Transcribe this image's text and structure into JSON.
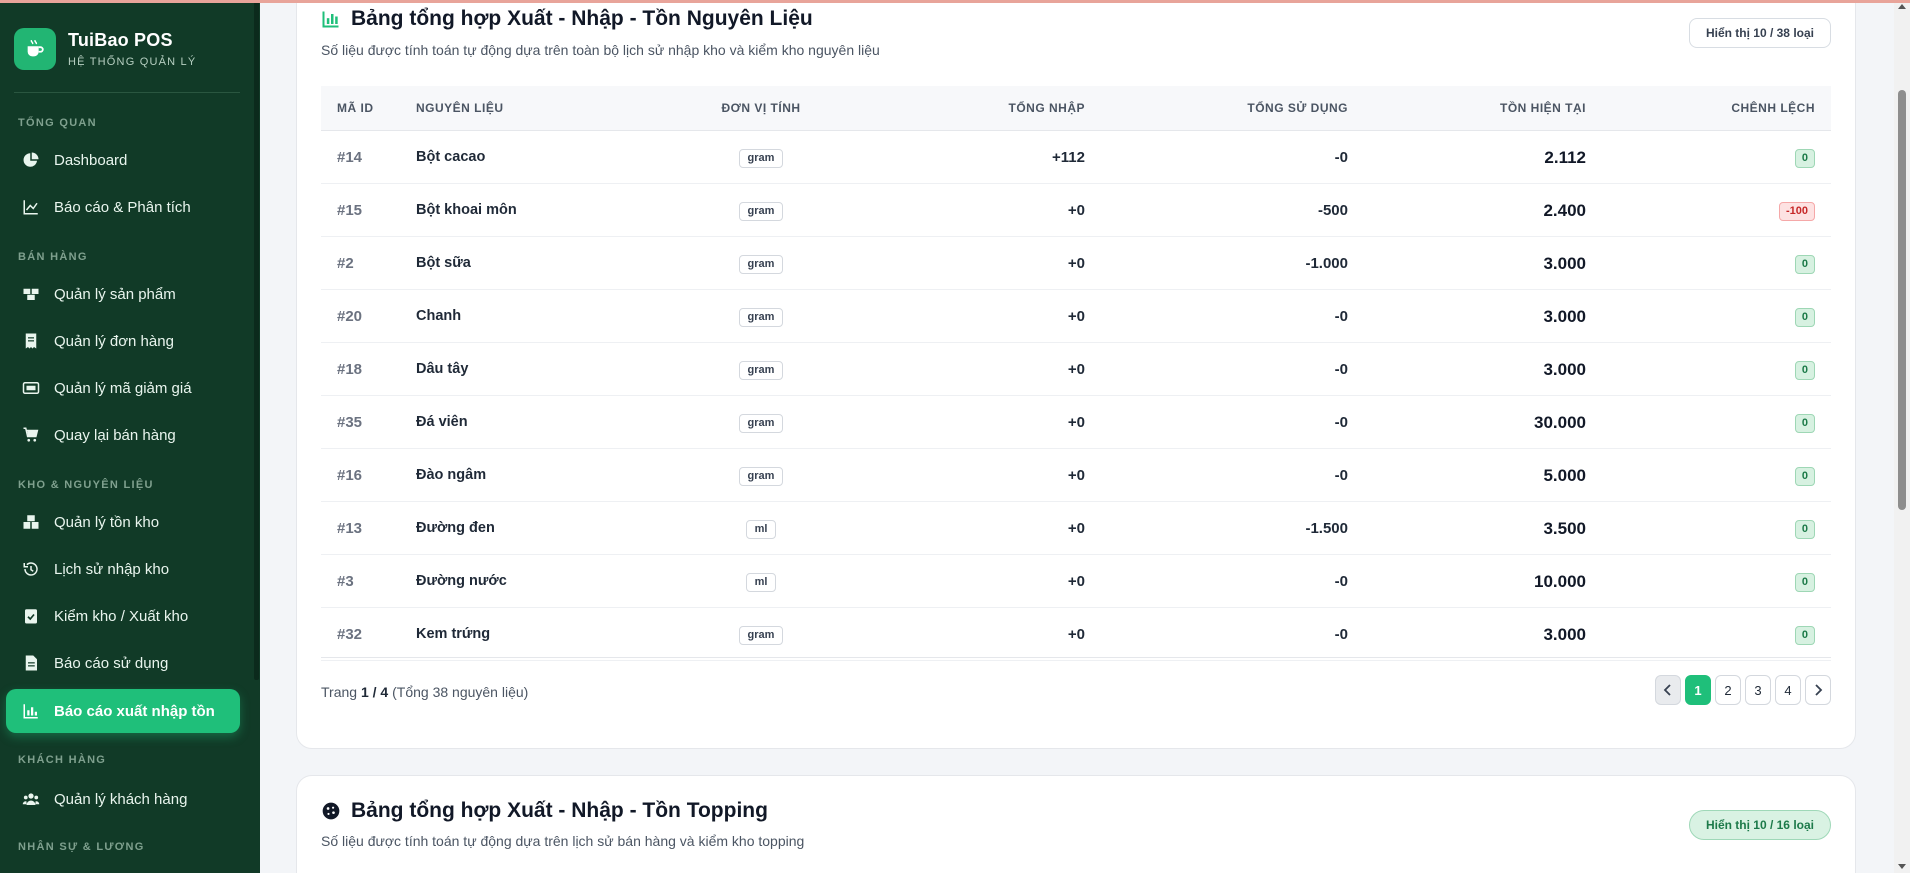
{
  "brand": {
    "name": "TuiBao POS",
    "subtitle": "HỆ THỐNG QUẢN LÝ"
  },
  "colors": {
    "sidebar_bg": "#113a27",
    "accent": "#1fbf7a",
    "negative": "#c62828"
  },
  "sidebar": {
    "sections": [
      {
        "label": "TỔNG QUAN",
        "items": [
          {
            "label": "Dashboard",
            "icon": "pie-chart-icon"
          },
          {
            "label": "Báo cáo & Phân tích",
            "icon": "line-chart-icon"
          }
        ]
      },
      {
        "label": "BÁN HÀNG",
        "items": [
          {
            "label": "Quản lý sản phẩm",
            "icon": "boxes-icon"
          },
          {
            "label": "Quản lý đơn hàng",
            "icon": "receipt-icon"
          },
          {
            "label": "Quản lý mã giảm giá",
            "icon": "ticket-icon"
          },
          {
            "label": "Quay lại bán hàng",
            "icon": "cart-icon"
          }
        ]
      },
      {
        "label": "KHO & NGUYÊN LIỆU",
        "items": [
          {
            "label": "Quản lý tồn kho",
            "icon": "warehouse-icon"
          },
          {
            "label": "Lịch sử nhập kho",
            "icon": "history-icon"
          },
          {
            "label": "Kiểm kho / Xuất kho",
            "icon": "clipboard-check-icon"
          },
          {
            "label": "Báo cáo sử dụng",
            "icon": "document-icon"
          },
          {
            "label": "Báo cáo xuất nhập tồn",
            "icon": "bar-chart-icon",
            "active": true
          }
        ]
      },
      {
        "label": "KHÁCH HÀNG",
        "items": [
          {
            "label": "Quản lý khách hàng",
            "icon": "users-icon"
          }
        ]
      },
      {
        "label": "NHÂN SỰ & LƯƠNG",
        "items": []
      }
    ]
  },
  "ingredients_card": {
    "title": "Bảng tổng hợp Xuất - Nhập - Tồn Nguyên Liệu",
    "subtitle": "Số liệu được tính toán tự động dựa trên toàn bộ lịch sử nhập kho và kiểm kho nguyên liệu",
    "badge": "Hiển thị 10 / 38 loại",
    "columns": [
      "MÃ ID",
      "NGUYÊN LIỆU",
      "ĐƠN VỊ TÍNH",
      "TỔNG NHẬP",
      "TỔNG SỬ DỤNG",
      "TỒN HIỆN TẠI",
      "CHÊNH LỆCH"
    ],
    "rows": [
      {
        "id": "#14",
        "name": "Bột cacao",
        "unit": "gram",
        "total_in": "+112",
        "total_used": "-0",
        "stock": "2.112",
        "diff": "0"
      },
      {
        "id": "#15",
        "name": "Bột khoai môn",
        "unit": "gram",
        "total_in": "+0",
        "total_used": "-500",
        "stock": "2.400",
        "diff": "-100"
      },
      {
        "id": "#2",
        "name": "Bột sữa",
        "unit": "gram",
        "total_in": "+0",
        "total_used": "-1.000",
        "stock": "3.000",
        "diff": "0"
      },
      {
        "id": "#20",
        "name": "Chanh",
        "unit": "gram",
        "total_in": "+0",
        "total_used": "-0",
        "stock": "3.000",
        "diff": "0"
      },
      {
        "id": "#18",
        "name": "Dâu tây",
        "unit": "gram",
        "total_in": "+0",
        "total_used": "-0",
        "stock": "3.000",
        "diff": "0"
      },
      {
        "id": "#35",
        "name": "Đá viên",
        "unit": "gram",
        "total_in": "+0",
        "total_used": "-0",
        "stock": "30.000",
        "diff": "0"
      },
      {
        "id": "#16",
        "name": "Đào ngâm",
        "unit": "gram",
        "total_in": "+0",
        "total_used": "-0",
        "stock": "5.000",
        "diff": "0"
      },
      {
        "id": "#13",
        "name": "Đường đen",
        "unit": "ml",
        "total_in": "+0",
        "total_used": "-1.500",
        "stock": "3.500",
        "diff": "0"
      },
      {
        "id": "#3",
        "name": "Đường nước",
        "unit": "ml",
        "total_in": "+0",
        "total_used": "-0",
        "stock": "10.000",
        "diff": "0"
      },
      {
        "id": "#32",
        "name": "Kem trứng",
        "unit": "gram",
        "total_in": "+0",
        "total_used": "-0",
        "stock": "3.000",
        "diff": "0"
      }
    ],
    "pagination": {
      "prefix": "Trang ",
      "current": "1",
      "sep": " / ",
      "total": "4",
      "suffix": " (Tổng 38 nguyên liệu)",
      "pages": [
        "1",
        "2",
        "3",
        "4"
      ]
    }
  },
  "topping_card": {
    "title": "Bảng tổng hợp Xuất - Nhập - Tồn Topping",
    "subtitle": "Số liệu được tính toán tự động dựa trên lịch sử bán hàng và kiểm kho topping",
    "badge": "Hiển thị 10 / 16 loại"
  }
}
